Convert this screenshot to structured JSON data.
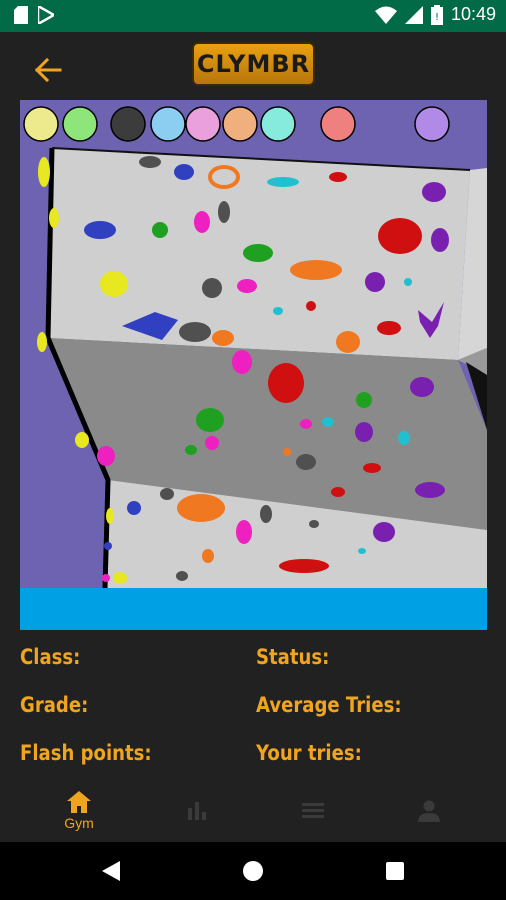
{
  "status_bar": {
    "time": "10:49",
    "left_icons": [
      "sd-card-icon",
      "play-store-icon"
    ],
    "right_icons": [
      "wifi-icon",
      "signal-icon",
      "battery-icon"
    ]
  },
  "app_bar": {
    "logo_text": "CLYMBR",
    "back_icon": "arrow-back-icon"
  },
  "colors": {
    "accent": "#f0a520",
    "background": "#212121",
    "wall_sky": "#6e63b0",
    "floor": "#00a0e4"
  },
  "color_filters": [
    {
      "name": "yellow",
      "color": "#ecea8c"
    },
    {
      "name": "green",
      "color": "#8ee67a"
    },
    {
      "name": "black",
      "color": "#3c3c3c"
    },
    {
      "name": "blue",
      "color": "#8ccdf2"
    },
    {
      "name": "pink",
      "color": "#eaa0dc"
    },
    {
      "name": "orange",
      "color": "#f0b07e"
    },
    {
      "name": "cyan",
      "color": "#86eadc"
    },
    {
      "name": "red",
      "color": "#ee8080"
    },
    {
      "name": "purple",
      "color": "#b08ae6"
    }
  ],
  "route_info": {
    "class_label": "Class:",
    "status_label": "Status:",
    "grade_label": "Grade:",
    "average_tries_label": "Average Tries:",
    "flash_points_label": "Flash points:",
    "your_tries_label": "Your tries:"
  },
  "bottom_nav": [
    {
      "label": "Gym",
      "icon": "home-icon",
      "active": true
    },
    {
      "label": "",
      "icon": "stats-icon",
      "active": false
    },
    {
      "label": "",
      "icon": "list-icon",
      "active": false
    },
    {
      "label": "",
      "icon": "person-icon",
      "active": false
    }
  ],
  "system_nav": [
    "back-triangle-icon",
    "home-circle-icon",
    "recents-square-icon"
  ]
}
